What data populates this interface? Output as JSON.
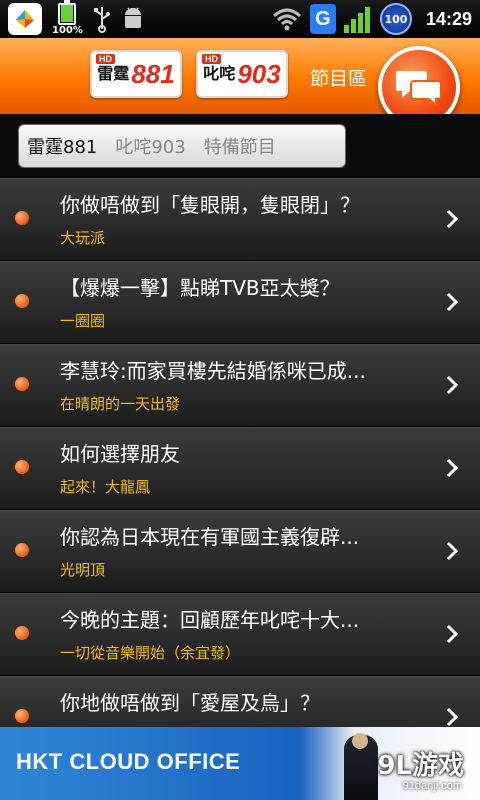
{
  "status_bar": {
    "battery_label": "100%",
    "signal_badge": "100",
    "time": "14:29",
    "g_label": "G"
  },
  "header": {
    "logo_881": {
      "hd": "HD",
      "name": "雷霆",
      "number": "881"
    },
    "logo_903": {
      "hd": "HD",
      "name": "叱咤",
      "number": "903"
    },
    "section_label": "節目區"
  },
  "tabs": [
    {
      "label": "雷霆881",
      "active": true
    },
    {
      "label": "叱咤903",
      "active": false
    },
    {
      "label": "特備節目",
      "active": false
    }
  ],
  "items": [
    {
      "title": "你做唔做到「隻眼開，隻眼閉」？",
      "program": "大玩派"
    },
    {
      "title": "【爆爆一擊】點睇TVB亞太獎？",
      "program": "一圈圈"
    },
    {
      "title": "李慧玲:而家買樓先結婚係咪已成...",
      "program": "在晴朗的一天出發"
    },
    {
      "title": "如何選擇朋友",
      "program": "起來！大龍鳳"
    },
    {
      "title": "你認為日本現在有軍國主義復辟...",
      "program": "光明頂"
    },
    {
      "title": "今晚的主題：回顧歷年叱咤十大...",
      "program": "一切從音樂開始（余宜發）"
    },
    {
      "title": "你地做唔做到「愛屋及烏」？",
      "program": ""
    }
  ],
  "ad": {
    "text": "HKT CLOUD OFFICE",
    "watermark": "9L游戏",
    "watermark_sub": "91danji.com"
  },
  "colors": {
    "header_orange": "#ff7a00",
    "program_yellow": "#f3b81a",
    "bullet_orange": "#f05a10"
  }
}
